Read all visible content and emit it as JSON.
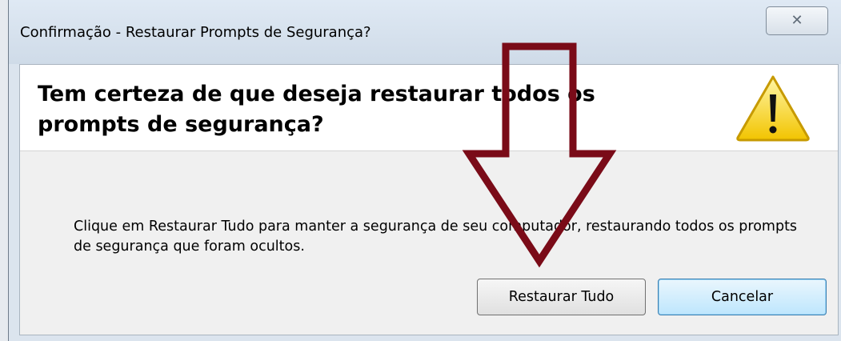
{
  "window": {
    "title": "Confirmação - Restaurar Prompts de Segurança?",
    "close_glyph": "✕"
  },
  "header": {
    "heading": "Tem certeza de que deseja restaurar todos os prompts de segurança?",
    "icon": "warning-icon"
  },
  "body": {
    "message": "Clique em Restaurar Tudo para manter a segurança de seu computador, restaurando todos os prompts de segurança que foram ocultos."
  },
  "buttons": {
    "restore_label": "Restaurar Tudo",
    "cancel_label": "Cancelar"
  },
  "annotation": {
    "arrow_color": "#7a0b18",
    "arrow_direction": "down"
  }
}
